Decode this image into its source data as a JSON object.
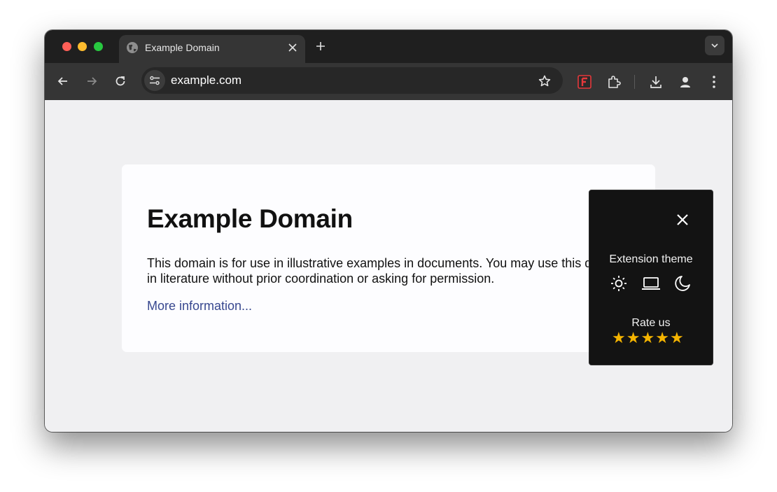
{
  "browser": {
    "tab": {
      "title": "Example Domain"
    },
    "address_bar": {
      "url": "example.com"
    }
  },
  "page": {
    "heading": "Example Domain",
    "paragraph": "This domain is for use in illustrative examples in documents. You may use this domain in literature without prior coordination or asking for permission.",
    "link": "More information..."
  },
  "extension_popup": {
    "theme_label": "Extension theme",
    "theme_options": [
      "sun-icon",
      "laptop-icon",
      "moon-icon"
    ],
    "rate_label": "Rate us",
    "stars": [
      "★",
      "★",
      "★",
      "★",
      "★"
    ],
    "star_color": "#f5b400"
  },
  "colors": {
    "link": "#38488f",
    "extension_accent": "#e5383b",
    "popup_bg": "#131313"
  }
}
